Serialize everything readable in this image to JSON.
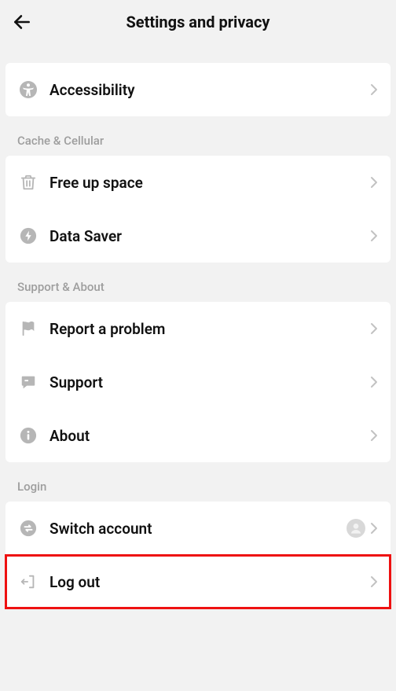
{
  "header": {
    "title": "Settings and privacy"
  },
  "sections": {
    "top": {
      "accessibility": "Accessibility"
    },
    "cache": {
      "header": "Cache & Cellular",
      "free_up_space": "Free up space",
      "data_saver": "Data Saver"
    },
    "support": {
      "header": "Support & About",
      "report": "Report a problem",
      "support": "Support",
      "about": "About"
    },
    "login": {
      "header": "Login",
      "switch_account": "Switch account",
      "log_out": "Log out"
    }
  }
}
